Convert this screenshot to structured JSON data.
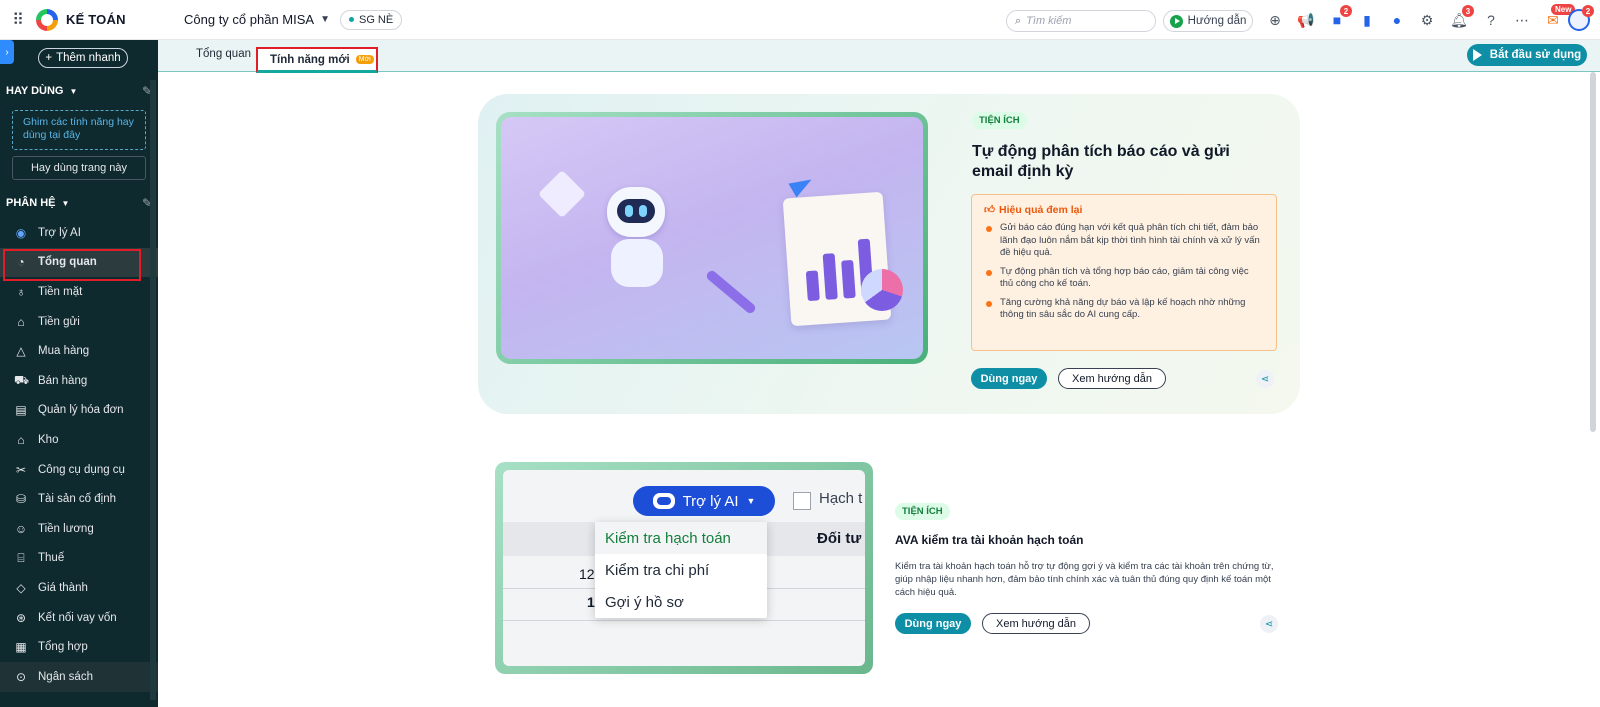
{
  "topbar": {
    "app_name": "KẾ TOÁN",
    "company": "Công ty cổ phần MISA",
    "branch": "SG NÈ",
    "search_placeholder": "Tìm kiếm",
    "guide_label": "Hướng dẫn",
    "badges": {
      "cart": "2",
      "notifications": "3",
      "avatar": "2"
    },
    "new_badge": "New"
  },
  "sidebar": {
    "quick_add": "Thêm nhanh",
    "favorites_title": "HAY DÙNG",
    "pin_hint": "Ghim các tính năng hay dùng tại đây",
    "favorite_page_btn": "Hay dùng trang này",
    "modules_title": "PHÂN HỆ",
    "items": [
      {
        "label": "Trợ lý AI",
        "icon": "robot-icon"
      },
      {
        "label": "Tổng quan",
        "icon": "dashboard-icon",
        "active": true
      },
      {
        "label": "Tiền mặt",
        "icon": "money-bag-icon"
      },
      {
        "label": "Tiền gửi",
        "icon": "bank-icon"
      },
      {
        "label": "Mua hàng",
        "icon": "shopping-bag-icon"
      },
      {
        "label": "Bán hàng",
        "icon": "cart-icon"
      },
      {
        "label": "Quản lý hóa đơn",
        "icon": "invoice-icon"
      },
      {
        "label": "Kho",
        "icon": "warehouse-icon"
      },
      {
        "label": "Công cụ dụng cụ",
        "icon": "tools-icon"
      },
      {
        "label": "Tài sản cố định",
        "icon": "asset-icon"
      },
      {
        "label": "Tiền lương",
        "icon": "payroll-icon"
      },
      {
        "label": "Thuế",
        "icon": "tax-icon"
      },
      {
        "label": "Giá thành",
        "icon": "price-tag-icon"
      },
      {
        "label": "Kết nối vay vốn",
        "icon": "loan-link-icon"
      },
      {
        "label": "Tổng hợp",
        "icon": "summary-icon"
      },
      {
        "label": "Ngân sách",
        "icon": "budget-icon"
      }
    ]
  },
  "tabs": {
    "overview": "Tổng quan",
    "new_features": "Tính năng mới",
    "new_tag": "Mới",
    "start_button": "Bắt đầu sử dụng"
  },
  "feature1": {
    "tag": "TIỆN ÍCH",
    "title": "Tự động phân tích báo cáo và gửi email định kỳ",
    "benefit_title": "Hiệu quả đem lại",
    "benefits": [
      "Gửi báo cáo đúng hạn với kết quả phân tích chi tiết, đảm bảo lãnh đạo luôn nắm bắt kịp thời tình hình tài chính và xử lý vấn đề hiệu quả.",
      "Tự động phân tích và tổng hợp báo cáo, giảm tải công việc thủ công cho kế toán.",
      "Tăng cường khả năng dự báo và lập kế hoạch nhờ những thông tin sâu sắc do AI cung cấp."
    ],
    "use_now": "Dùng ngay",
    "view_guide": "Xem hướng dẫn"
  },
  "feature2": {
    "tag": "TIỆN ÍCH",
    "title": "AVA kiểm tra tài khoản hạch toán",
    "description": "Kiểm tra tài khoản hạch toán hỗ trợ tự động gợi ý và kiểm tra các tài khoản trên chứng từ, giúp nhập liệu nhanh hơn, đảm bảo tính chính xác và tuân thủ đúng quy định kế toán một cách hiệu quả.",
    "use_now": "Dùng ngay",
    "view_guide": "Xem hướng dẫn",
    "illustration": {
      "assistant_label": "Trợ lý AI",
      "checkbox_label": "Hạch t",
      "column_header": "Đối tư",
      "row1": "12",
      "row2": "1",
      "menu": [
        "Kiểm tra hạch toán",
        "Kiểm tra chi phí",
        "Gợi ý hồ sơ"
      ]
    }
  },
  "colors": {
    "sidebar_bg": "#0f2a2e",
    "accent": "#0e8fa6",
    "highlight": "#e11d2a"
  }
}
